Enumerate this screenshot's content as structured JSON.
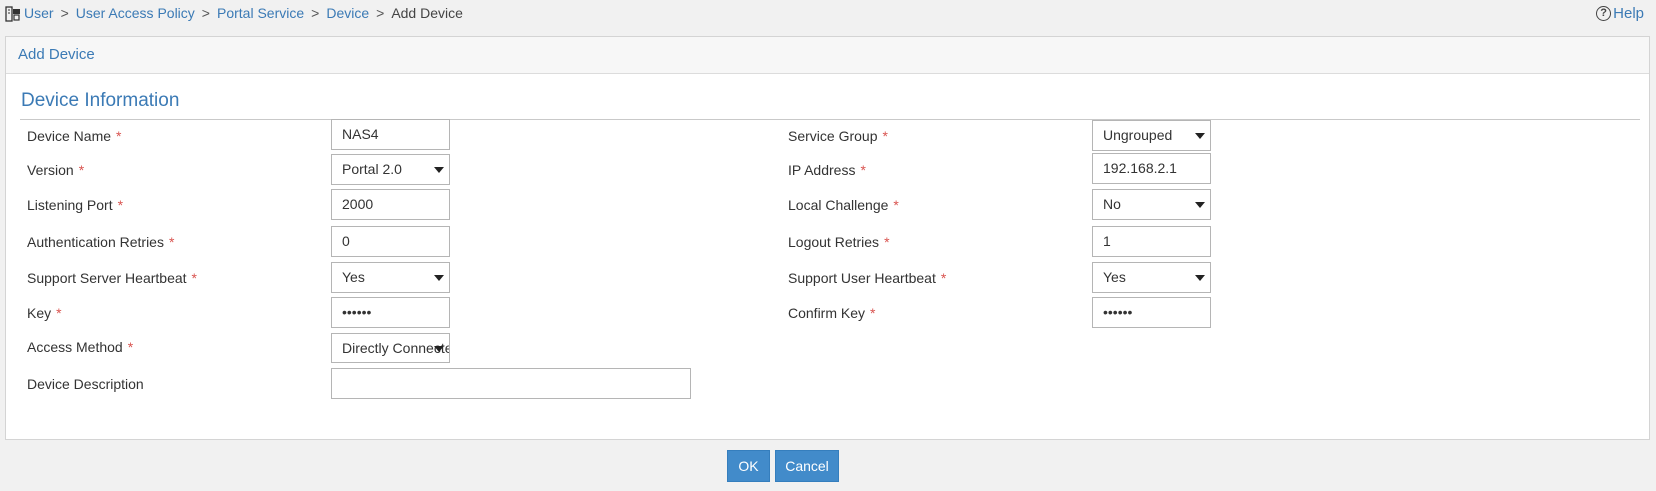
{
  "breadcrumb": {
    "items": [
      "User",
      "User Access Policy",
      "Portal Service",
      "Device"
    ],
    "separator": ">",
    "current": "Add Device"
  },
  "help_label": "Help",
  "panel_title": "Add Device",
  "section_title": "Device Information",
  "required_marker": "*",
  "left_fields": [
    {
      "label": "Device Name",
      "value": "NAS4",
      "type": "input",
      "required": true
    },
    {
      "label": "Version",
      "value": "Portal 2.0",
      "type": "select",
      "required": true
    },
    {
      "label": "Listening Port",
      "value": "2000",
      "type": "input",
      "required": true
    },
    {
      "label": "Authentication Retries",
      "value": "0",
      "type": "input",
      "required": true
    },
    {
      "label": "Support Server Heartbeat",
      "value": "Yes",
      "type": "select",
      "required": true
    },
    {
      "label": "Key",
      "value": "••••••",
      "type": "password",
      "required": true
    },
    {
      "label": "Access Method",
      "value": "Directly Connected",
      "type": "select",
      "required": true
    },
    {
      "label": "Device Description",
      "value": "",
      "type": "wide",
      "required": false
    }
  ],
  "right_fields": [
    {
      "label": "Service Group",
      "value": "Ungrouped",
      "type": "select",
      "required": true
    },
    {
      "label": "IP Address",
      "value": "192.168.2.1",
      "type": "input",
      "required": true
    },
    {
      "label": "Local Challenge",
      "value": "No",
      "type": "select",
      "required": true
    },
    {
      "label": "Logout Retries",
      "value": "1",
      "type": "input",
      "required": true
    },
    {
      "label": "Support User Heartbeat",
      "value": "Yes",
      "type": "select",
      "required": true
    },
    {
      "label": "Confirm Key",
      "value": "••••••",
      "type": "password",
      "required": true
    }
  ],
  "buttons": {
    "ok": "OK",
    "cancel": "Cancel"
  },
  "colors": {
    "link": "#3b7ab5",
    "required": "#d9534f",
    "button": "#428bca"
  }
}
